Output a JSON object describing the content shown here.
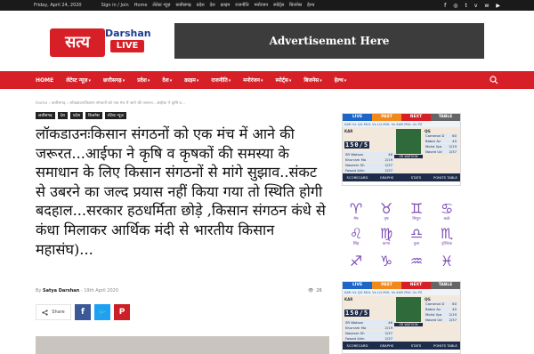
{
  "topbar": {
    "date": "Friday, April 24, 2020",
    "links": [
      "Sign in / Join",
      "Home",
      "लेटेस्ट न्यूज़",
      "छत्तीसगढ़",
      "प्रदेश",
      "देश",
      "क्राइम",
      "राजनीति",
      "मनोरंजन",
      "स्पोर्ट्स",
      "बिजनेस",
      "हेल्थ"
    ],
    "social_icons": [
      "facebook-icon",
      "instagram-icon",
      "twitter-icon",
      "vimeo-icon",
      "vk-icon",
      "youtube-icon"
    ]
  },
  "logo": {
    "part1": "सत्य",
    "part2": "Darshan",
    "part3": "LIVE"
  },
  "ad": {
    "label": "Advertisement Here"
  },
  "nav": {
    "items": [
      {
        "label": "HOME",
        "dropdown": false
      },
      {
        "label": "लेटेस्ट न्यूज़",
        "dropdown": true
      },
      {
        "label": "छत्तीसगढ़",
        "dropdown": true
      },
      {
        "label": "प्रदेश",
        "dropdown": true
      },
      {
        "label": "देश",
        "dropdown": true
      },
      {
        "label": "क्राइम",
        "dropdown": true
      },
      {
        "label": "राजनीति",
        "dropdown": true
      },
      {
        "label": "मनोरंजन",
        "dropdown": true
      },
      {
        "label": "स्पोर्ट्स",
        "dropdown": true
      },
      {
        "label": "बिजनेस",
        "dropdown": true
      },
      {
        "label": "हेल्थ",
        "dropdown": true
      }
    ]
  },
  "breadcrumb": "Home  ›  छत्तीसगढ़  ›  लॉकडाउनःकिसान संगठनों को एक मंच में आने की जरूरत...आईफा ने कृषि व...",
  "categories": [
    "छत्तीसगढ़",
    "देश",
    "प्रदेश",
    "बिजनेस",
    "लेटेस्ट न्यूज़"
  ],
  "article": {
    "title": "लॉकडाउनःकिसान संगठनों को एक मंच में आने की जरूरत...आईफा ने कृषि व कृषकों की समस्या के समाधान के लिए किसान संगठनों से मांगे सुझाव..संकट से उबरने का जल्द प्रयास नहीं किया गया तो स्थिति होगी बदहाल...सरकार हठधर्मिता छोड़े ,किसान संगठन कंधे से कंधा मिलाकर आर्थिक मंदी से भारतीय किसान महासंघ)...",
    "by": "By",
    "author": "Satya Darshan",
    "date": "19th April 2020",
    "views": "26",
    "share_label": "Share"
  },
  "scoreboards": [
    {
      "tabs": [
        "LIVE",
        "PAST",
        "NEXT",
        "TABLE"
      ],
      "teams_line": "KAR Vs QG   MUL Vs LQ   MUL Vs KAR   MUL Vs PZ",
      "team_left": "KAR",
      "score": "150/5",
      "players": [
        [
          "SR Watson",
          "46"
        ],
        [
          "Khurram Ma",
          "2/19"
        ],
        [
          "Naseem Sh",
          "2/37"
        ],
        [
          "Fawad Alim",
          "2/37"
        ]
      ],
      "mid_name": "SR WATSON",
      "team_right": "QG",
      "right_players": [
        [
          "Cameron D",
          "60"
        ],
        [
          "Babar Az",
          "40"
        ],
        [
          "Mohd Ilya",
          "2/19"
        ],
        [
          "Naved Ud",
          "2/37"
        ]
      ],
      "foot": [
        "SCORECARD",
        "GRAPHS",
        "STATS",
        "POINTS TABLE"
      ]
    },
    {
      "tabs": [
        "LIVE",
        "PAST",
        "NEXT",
        "TABLE"
      ],
      "teams_line": "KAR Vs QG   MUL Vs LQ   MUL Vs KAR   MUL Vs PZ",
      "team_left": "KAR",
      "score": "150/5",
      "players": [
        [
          "SR Watson",
          "46"
        ],
        [
          "Khurram Ma",
          "2/19"
        ],
        [
          "Naseem Sh",
          "2/37"
        ],
        [
          "Fawad Alim",
          "2/37"
        ]
      ],
      "mid_name": "SR WATSON",
      "team_right": "QG",
      "right_players": [
        [
          "Cameron D",
          "60"
        ],
        [
          "Babar Az",
          "40"
        ],
        [
          "Mohd Ilya",
          "2/19"
        ],
        [
          "Naved Ud",
          "2/37"
        ]
      ],
      "foot": [
        "SCORECARD",
        "GRAPHS",
        "STATS",
        "POINTS TABLE"
      ]
    }
  ],
  "zodiac": [
    {
      "glyph": "♈",
      "label": "मेष"
    },
    {
      "glyph": "♉",
      "label": "वृष"
    },
    {
      "glyph": "♊",
      "label": "मिथुन"
    },
    {
      "glyph": "♋",
      "label": "कर्क"
    },
    {
      "glyph": "♌",
      "label": "सिंह"
    },
    {
      "glyph": "♍",
      "label": "कन्या"
    },
    {
      "glyph": "♎",
      "label": "तुला"
    },
    {
      "glyph": "♏",
      "label": "वृश्चिक"
    },
    {
      "glyph": "♐",
      "label": ""
    },
    {
      "glyph": "♑",
      "label": ""
    },
    {
      "glyph": "♒",
      "label": ""
    },
    {
      "glyph": "♓",
      "label": ""
    }
  ],
  "colors": {
    "brand_red": "#d61f26",
    "dark": "#1a1a1a",
    "live_tab": "#1d66c7",
    "past_tab": "#f08a1c",
    "next_tab": "#d61f26",
    "table_tab": "#666666",
    "zodiac": "#7b4bb5"
  }
}
